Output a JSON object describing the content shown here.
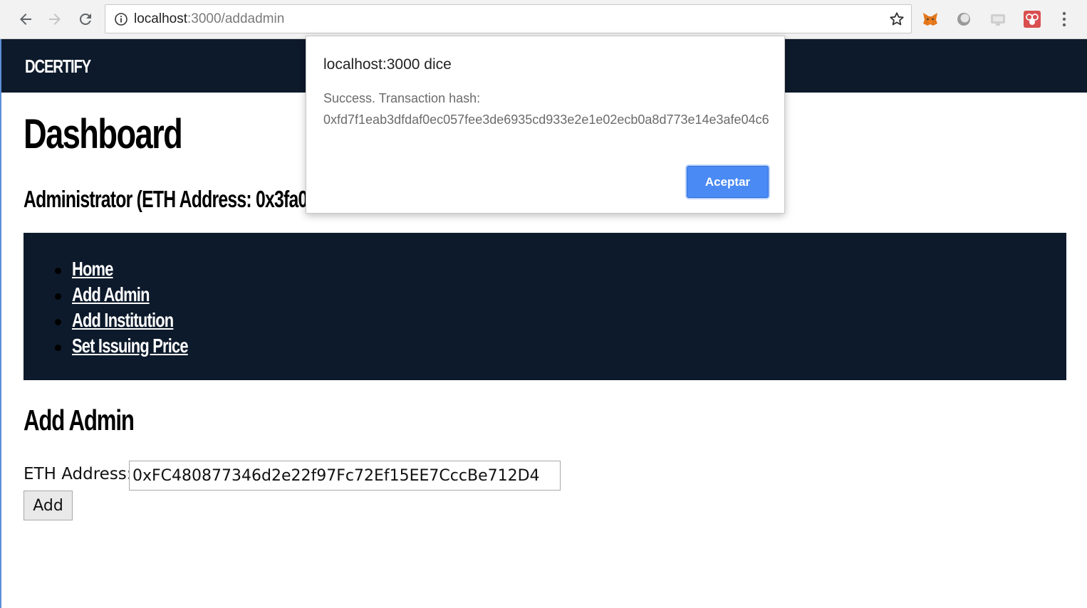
{
  "browser": {
    "url_host": "localhost",
    "url_path": ":3000/addadmin"
  },
  "site": {
    "brand": "DCERTIFY"
  },
  "page": {
    "title": "Dashboard",
    "admin_heading": "Administrator (ETH Address: 0x3fa0",
    "nav": [
      {
        "label": "Home"
      },
      {
        "label": "Add Admin"
      },
      {
        "label": "Add Institution"
      },
      {
        "label": "Set Issuing Price"
      }
    ],
    "section_title": "Add Admin",
    "form": {
      "eth_label": "ETH Address:",
      "eth_value": "0xFC480877346d2e22f97Fc72Ef15EE7CccBe712D4",
      "submit_label": "Add"
    }
  },
  "dialog": {
    "title": "localhost:3000 dice",
    "message_line1": "Success. Transaction hash:",
    "message_hash": "0xfd7f1eab3dfdaf0ec057fee3de6935cd933e2e1e02ecb0a8d773e14e3afe04c6",
    "ok_label": "Aceptar"
  },
  "colors": {
    "navy": "#0d1a2b",
    "dialog_button": "#4a8af4"
  }
}
